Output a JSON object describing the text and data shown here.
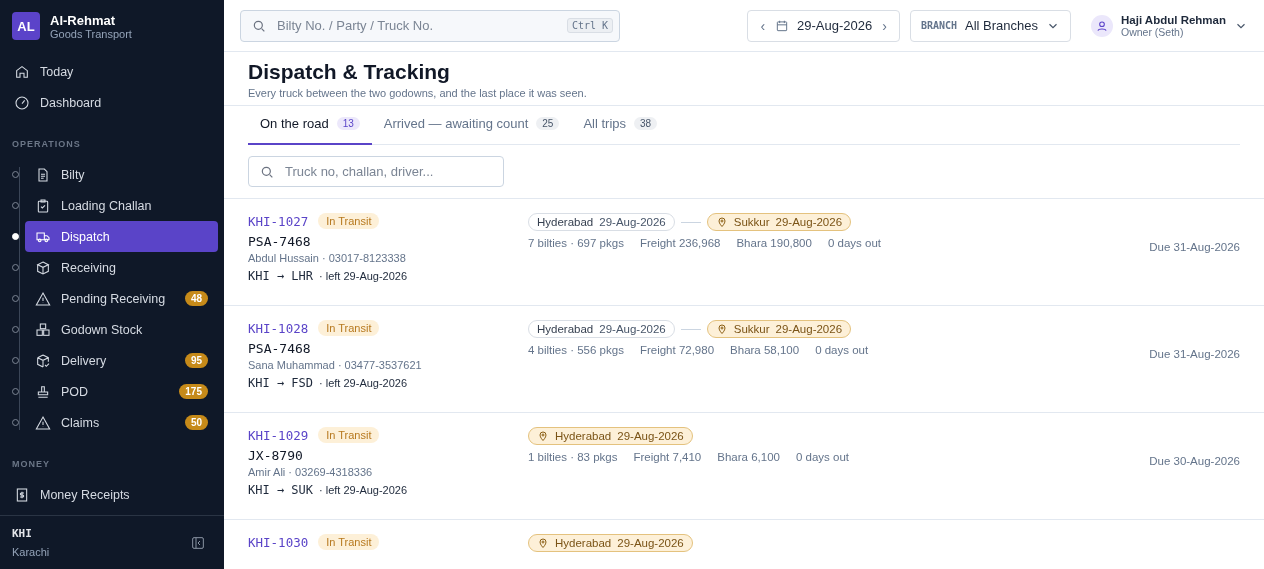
{
  "brand": {
    "initials": "AL",
    "name": "Al-Rehmat",
    "subtitle": "Goods Transport"
  },
  "nav_top": [
    {
      "label": "Today",
      "selected": false
    },
    {
      "label": "Dashboard",
      "selected": false
    }
  ],
  "sections": [
    {
      "title": "OPERATIONS",
      "items": [
        {
          "label": "Bilty",
          "selected": false
        },
        {
          "label": "Loading Challan",
          "selected": false
        },
        {
          "label": "Dispatch",
          "selected": true
        },
        {
          "label": "Receiving",
          "selected": false
        },
        {
          "label": "Pending Receiving",
          "selected": false,
          "badge": "48"
        },
        {
          "label": "Godown Stock",
          "selected": false
        },
        {
          "label": "Delivery",
          "selected": false,
          "badge": "95"
        },
        {
          "label": "POD",
          "selected": false,
          "badge": "175"
        },
        {
          "label": "Claims",
          "selected": false,
          "badge": "50"
        }
      ]
    },
    {
      "title": "MONEY",
      "items": [
        {
          "label": "Money Receipts",
          "selected": false
        }
      ]
    }
  ],
  "sidebar_footer": {
    "code": "KHI",
    "city": "Karachi"
  },
  "topbar": {
    "search_placeholder": "Bilty No. / Party / Truck No.",
    "shortcut": "Ctrl K",
    "prev": "‹",
    "date": "29-Aug-2026",
    "next": "›",
    "branch_label": "BRANCH",
    "branch": "All Branches",
    "user_name": "Haji Abdul Rehman",
    "user_role": "Owner (Seth)"
  },
  "page": {
    "title": "Dispatch & Tracking",
    "subtitle": "Every truck between the two godowns, and the last place it was seen."
  },
  "tabs": [
    {
      "label": "On the road",
      "count": "13",
      "selected": true
    },
    {
      "label": "Arrived — awaiting count",
      "count": "25",
      "selected": false
    },
    {
      "label": "All trips",
      "count": "38",
      "selected": false
    }
  ],
  "filter": {
    "placeholder": "Truck no, challan, driver..."
  },
  "trips": [
    {
      "id": "KHI-1027",
      "status": "In Transit",
      "truck": "PSA-7468",
      "driver": "Abdul Hussain · 03017-8123338",
      "route": "KHI → LHR",
      "left": "· left 29-Aug-2026",
      "stops": [
        {
          "kind": "passed",
          "place": "Hyderabad",
          "date": "29-Aug-2026"
        },
        {
          "kind": "current",
          "place": "Sukkur",
          "date": "29-Aug-2026"
        }
      ],
      "stats": [
        "7 bilties · 697 pkgs",
        "Freight 236,968",
        "Bhara 190,800",
        "0 days out"
      ],
      "due": "Due 31-Aug-2026"
    },
    {
      "id": "KHI-1028",
      "status": "In Transit",
      "truck": "PSA-7468",
      "driver": "Sana Muhammad · 03477-3537621",
      "route": "KHI → FSD",
      "left": "· left 29-Aug-2026",
      "stops": [
        {
          "kind": "passed",
          "place": "Hyderabad",
          "date": "29-Aug-2026"
        },
        {
          "kind": "current",
          "place": "Sukkur",
          "date": "29-Aug-2026"
        }
      ],
      "stats": [
        "4 bilties · 556 pkgs",
        "Freight 72,980",
        "Bhara 58,100",
        "0 days out"
      ],
      "due": "Due 31-Aug-2026"
    },
    {
      "id": "KHI-1029",
      "status": "In Transit",
      "truck": "JX-8790",
      "driver": "Amir Ali · 03269-4318336",
      "route": "KHI → SUK",
      "left": "· left 29-Aug-2026",
      "stops": [
        {
          "kind": "current",
          "place": "Hyderabad",
          "date": "29-Aug-2026"
        }
      ],
      "stats": [
        "1 bilties · 83 pkgs",
        "Freight 7,410",
        "Bhara 6,100",
        "0 days out"
      ],
      "due": "Due 30-Aug-2026"
    },
    {
      "id": "KHI-1030",
      "status": "In Transit",
      "stops": [
        {
          "kind": "current",
          "place": "Hyderabad",
          "date": "29-Aug-2026"
        }
      ]
    }
  ]
}
